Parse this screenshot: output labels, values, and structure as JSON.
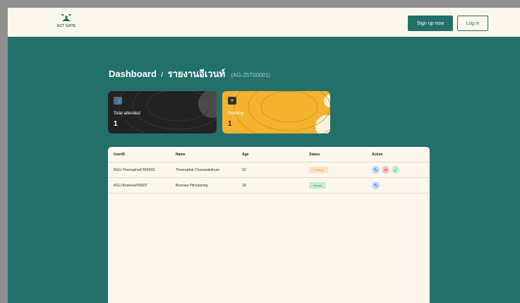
{
  "header": {
    "logo_text": "ACT GATE",
    "signup_label": "Sign up now",
    "login_label": "Log in"
  },
  "page": {
    "title": "Dashboard",
    "separator": "/",
    "subtitle": "รายงานอีเวนท์",
    "event_code": "(AG-25T00001)"
  },
  "cards": [
    {
      "label": "Total attended",
      "value": "1",
      "icon": "user-icon"
    },
    {
      "label": "Pedding",
      "value": "1",
      "icon": "clock-icon"
    }
  ],
  "table": {
    "columns": [
      "UserID",
      "Name",
      "Age",
      "Status",
      "Action"
    ],
    "rows": [
      {
        "user_id": "AGU-TheeraphatCH00001",
        "name": "Theeraphat Chueanakkhum",
        "age": "20",
        "status": "Pedding",
        "status_kind": "pending",
        "actions": [
          "edit",
          "reject",
          "approve"
        ]
      },
      {
        "user_id": "AGU-BoonisaP00007",
        "name": "Boonisa Pitchawong",
        "age": "18",
        "status": "Accept",
        "status_kind": "accept",
        "actions": [
          "edit"
        ]
      }
    ]
  },
  "colors": {
    "brand": "#23706a",
    "header_bg": "#fbf7ec",
    "card_dark": "#222222",
    "card_yellow": "#f4b22e"
  }
}
